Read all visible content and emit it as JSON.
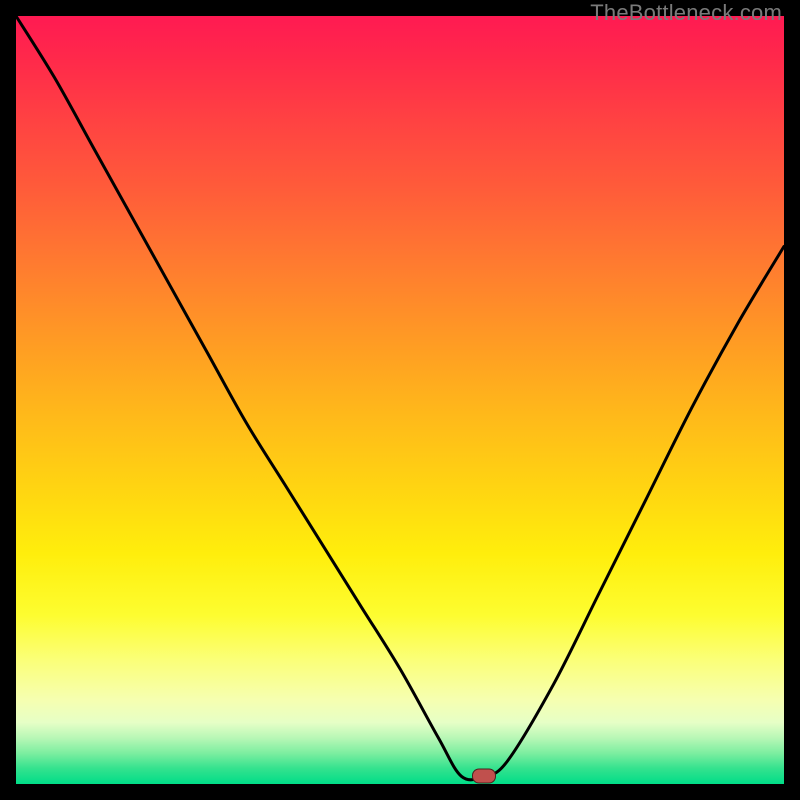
{
  "watermark": "TheBottleneck.com",
  "marker": {
    "x_frac": 0.61,
    "y_frac": 0.99
  },
  "chart_data": {
    "type": "line",
    "title": "",
    "xlabel": "",
    "ylabel": "",
    "xlim": [
      0,
      1
    ],
    "ylim": [
      0,
      1
    ],
    "series": [
      {
        "name": "bottleneck-curve",
        "x": [
          0.0,
          0.05,
          0.1,
          0.15,
          0.2,
          0.25,
          0.3,
          0.35,
          0.4,
          0.45,
          0.5,
          0.55,
          0.58,
          0.61,
          0.64,
          0.7,
          0.76,
          0.82,
          0.88,
          0.94,
          1.0
        ],
        "y": [
          1.0,
          0.92,
          0.83,
          0.74,
          0.65,
          0.56,
          0.47,
          0.39,
          0.31,
          0.23,
          0.15,
          0.06,
          0.01,
          0.01,
          0.03,
          0.13,
          0.25,
          0.37,
          0.49,
          0.6,
          0.7
        ]
      }
    ],
    "annotations": [
      {
        "name": "optimal-marker",
        "x": 0.61,
        "y": 0.01
      }
    ],
    "background_gradient": {
      "top_color": "#ff1a52",
      "bottom_color": "#00dd88"
    }
  }
}
